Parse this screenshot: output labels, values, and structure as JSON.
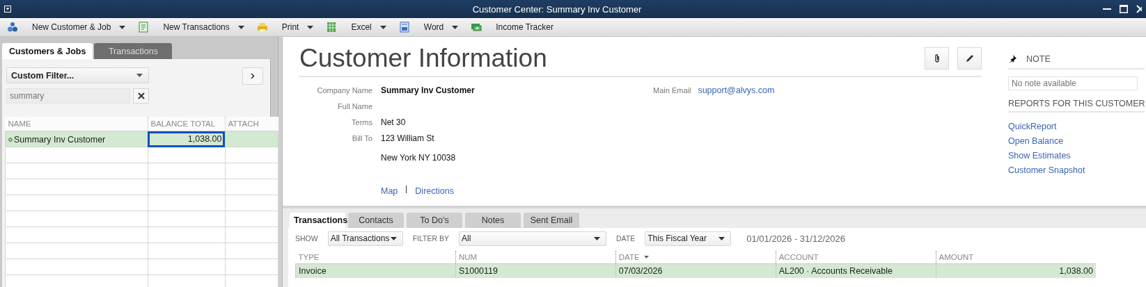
{
  "window": {
    "title": "Customer Center: Summary Inv Customer"
  },
  "toolbar": [
    {
      "kind": "customer",
      "label": "New Customer & Job",
      "dropdown": true
    },
    {
      "kind": "transaction",
      "label": "New Transactions",
      "dropdown": true
    },
    {
      "kind": "print",
      "label": "Print",
      "dropdown": true
    },
    {
      "kind": "excel",
      "label": "Excel",
      "dropdown": true
    },
    {
      "kind": "word",
      "label": "Word",
      "dropdown": true
    },
    {
      "kind": "tracker",
      "label": "Income Tracker",
      "dropdown": false
    }
  ],
  "left_tabs": [
    {
      "label": "Customers & Jobs",
      "selected": true
    },
    {
      "label": "Transactions",
      "selected": false
    }
  ],
  "filter": {
    "value": "Custom Filter..."
  },
  "search": {
    "placeholder": "summary"
  },
  "customer_table": {
    "columns": [
      "NAME",
      "BALANCE TOTAL",
      "ATTACH"
    ],
    "rows": [
      {
        "name": "Summary Inv Customer",
        "balance_total": "1,038.00",
        "selected": true
      }
    ]
  },
  "customer_info": {
    "title": "Customer Information",
    "fields": [
      {
        "label": "Company Name",
        "value": "Summary Inv Customer",
        "bold": true
      },
      {
        "label": "Full Name"
      },
      {
        "label": "Terms",
        "value": "Net 30",
        "bold": false
      },
      {
        "label": "Bill To",
        "lines": [
          "123 William St",
          "New York NY 10038"
        ]
      }
    ],
    "main_email": {
      "label": "Main Email",
      "value": "support@alvys.com"
    },
    "links": [
      "Map",
      "Directions"
    ]
  },
  "note": {
    "title": "NOTE",
    "placeholder": "No note available"
  },
  "reports": {
    "title": "REPORTS FOR THIS CUSTOMER",
    "links": [
      "QuickReport",
      "Open Balance",
      "Show Estimates",
      "Customer Snapshot"
    ]
  },
  "detail_tabs": [
    {
      "label": "Transactions",
      "selected": true
    },
    {
      "label": "Contacts",
      "selected": false
    },
    {
      "label": "To Do's",
      "selected": false
    },
    {
      "label": "Notes",
      "selected": false
    },
    {
      "label": "Sent Email",
      "selected": false
    }
  ],
  "filters": [
    {
      "label": "SHOW",
      "value": "All Transactions"
    },
    {
      "label": "FILTER BY",
      "value": "All"
    },
    {
      "label": "DATE",
      "value": "This Fiscal Year"
    }
  ],
  "date_range": "01/01/2026 - 31/12/2026",
  "transactions": {
    "columns": [
      {
        "label": "TYPE",
        "sorted": false
      },
      {
        "label": "NUM",
        "sorted": false
      },
      {
        "label": "DATE",
        "sorted": true
      },
      {
        "label": "ACCOUNT",
        "sorted": false
      },
      {
        "label": "AMOUNT",
        "sorted": false
      }
    ],
    "rows": [
      {
        "cells": [
          "Invoice",
          "S1000119",
          "07/03/2026",
          "AL200 · Accounts Receivable",
          "1,038.00"
        ],
        "selected": true
      }
    ]
  }
}
